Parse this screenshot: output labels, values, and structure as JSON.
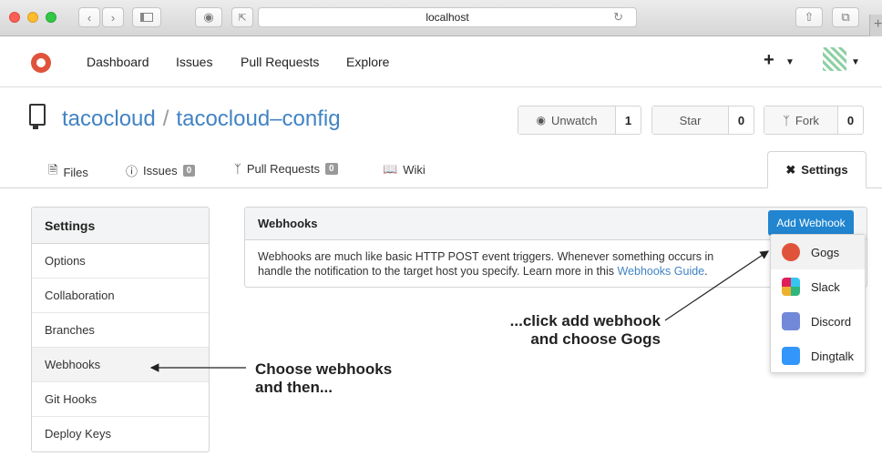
{
  "browser": {
    "url": "localhost",
    "back_icon": "chevron-left-icon",
    "forward_icon": "chevron-right-icon",
    "reload_icon": "reload-icon"
  },
  "sitenav": {
    "items": [
      "Dashboard",
      "Issues",
      "Pull Requests",
      "Explore"
    ],
    "plus": "+"
  },
  "repo": {
    "owner": "tacocloud",
    "separator": "/",
    "name": "tacocloud–config",
    "watch": {
      "label": "Unwatch",
      "count": "1"
    },
    "star": {
      "label": "Star",
      "count": "0"
    },
    "fork": {
      "label": "Fork",
      "count": "0"
    }
  },
  "tabs": {
    "files": "Files",
    "issues": "Issues",
    "issues_count": "0",
    "pulls": "Pull Requests",
    "pulls_count": "0",
    "wiki": "Wiki",
    "settings": "Settings"
  },
  "sidebar": {
    "title": "Settings",
    "items": [
      "Options",
      "Collaboration",
      "Branches",
      "Webhooks",
      "Git Hooks",
      "Deploy Keys"
    ],
    "active": "Webhooks"
  },
  "webhooks": {
    "title": "Webhooks",
    "add_label": "Add Webhook",
    "description_line1": "Webhooks are much like basic HTTP POST event triggers. Whenever something occurs in",
    "description_line2": "handle the notification to the target host you specify. Learn more in this",
    "guide_link": "Webhooks Guide",
    "guide_end": ".",
    "types": [
      {
        "label": "Gogs",
        "icon": "gogs-icon",
        "color": "#e0533b"
      },
      {
        "label": "Slack",
        "icon": "slack-icon",
        "color": "#e01e5a"
      },
      {
        "label": "Discord",
        "icon": "discord-icon",
        "color": "#7289da"
      },
      {
        "label": "Dingtalk",
        "icon": "dingtalk-icon",
        "color": "#3296fa"
      }
    ]
  },
  "annotations": {
    "left_line1": "Choose webhooks",
    "left_line2": "and then...",
    "right_line1": "...click add webhook",
    "right_line2": "and choose Gogs"
  },
  "colors": {
    "link": "#4183c4",
    "primary_button": "#2185d0",
    "brand": "#e0533b"
  }
}
